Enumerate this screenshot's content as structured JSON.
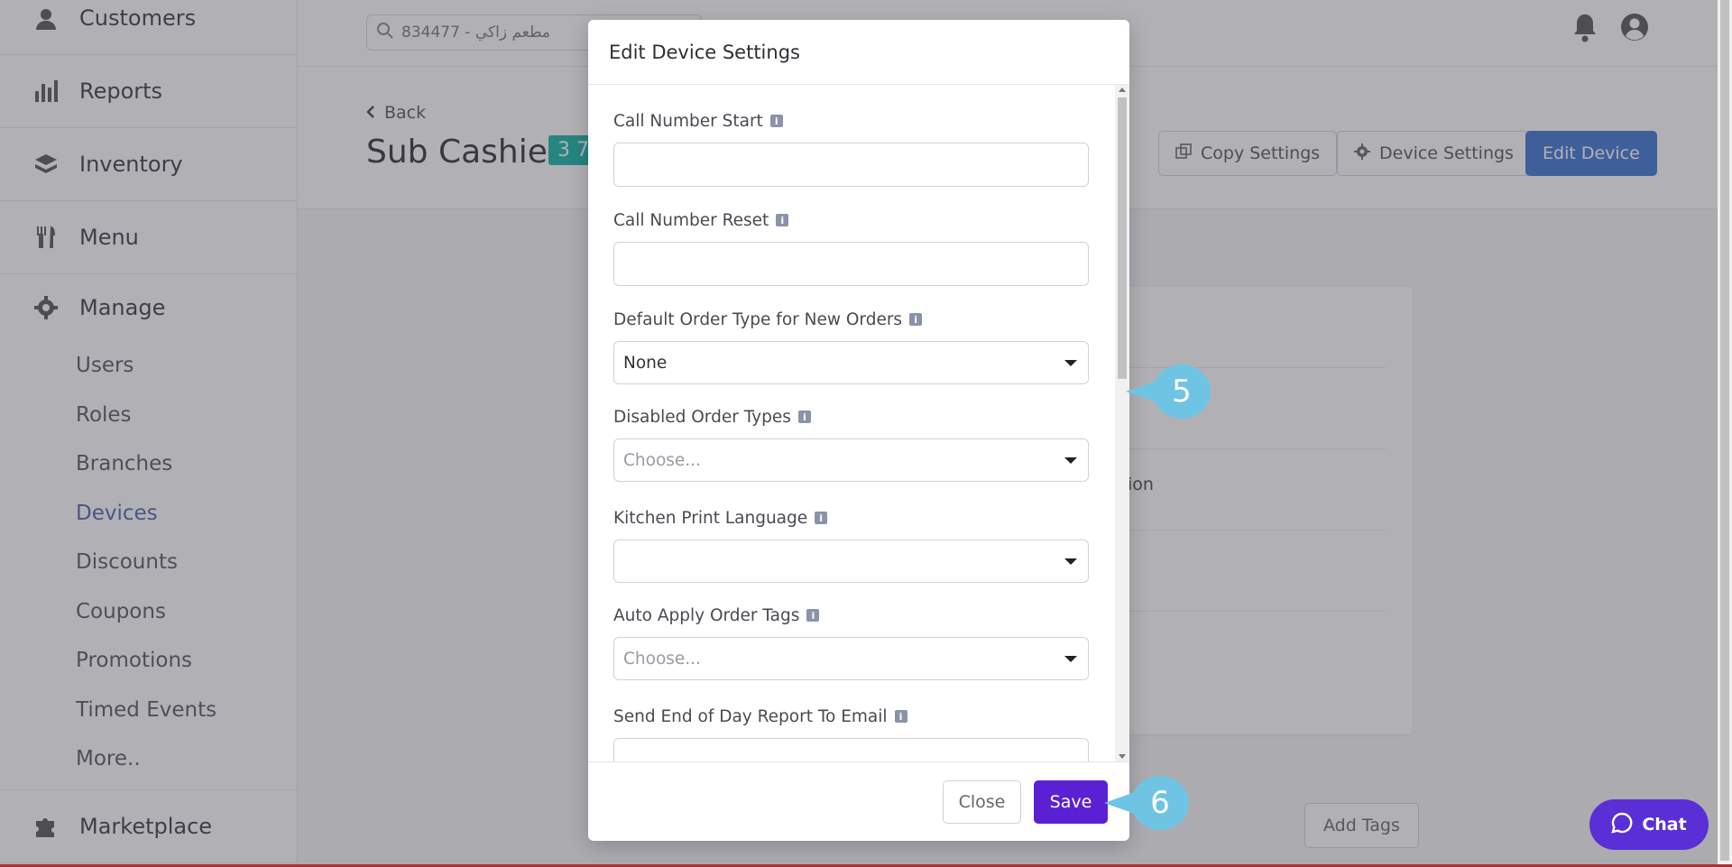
{
  "sidebar": {
    "customers": "Customers",
    "reports": "Reports",
    "inventory": "Inventory",
    "menu": "Menu",
    "manage": "Manage",
    "sub_items": [
      "Users",
      "Roles",
      "Branches",
      "Devices",
      "Discounts",
      "Coupons",
      "Promotions",
      "Timed Events",
      "More.."
    ],
    "marketplace": "Marketplace"
  },
  "header": {
    "search_value": "834477 - مطعم زاكي",
    "back_label": "Back",
    "page_title": "Sub Cashier",
    "ref_badge": "3 7",
    "copy_settings": "Copy Settings",
    "device_settings": "Device Settings",
    "edit_device": "Edit Device"
  },
  "background": {
    "snippet": "ion",
    "add_tags": "Add Tags"
  },
  "modal": {
    "title": "Edit Device Settings",
    "fields": {
      "call_number_start": {
        "label": "Call Number Start",
        "value": ""
      },
      "call_number_reset": {
        "label": "Call Number Reset",
        "value": ""
      },
      "default_order_type": {
        "label": "Default Order Type for New Orders",
        "value": "None"
      },
      "disabled_order_types": {
        "label": "Disabled Order Types",
        "placeholder": "Choose..."
      },
      "kitchen_print_language": {
        "label": "Kitchen Print Language",
        "value": ""
      },
      "auto_apply_order_tags": {
        "label": "Auto Apply Order Tags",
        "placeholder": "Choose..."
      },
      "send_eod_report": {
        "label": "Send End of Day Report To Email",
        "value": ""
      }
    },
    "close_label": "Close",
    "save_label": "Save"
  },
  "callouts": {
    "step5": "5",
    "step6": "6"
  },
  "chat_label": "Chat",
  "colors": {
    "primary": "#3b73d1",
    "save": "#5a21d4",
    "callout": "#6fc4e4",
    "badge": "#10b3a2",
    "chat": "#5a2fd6"
  }
}
